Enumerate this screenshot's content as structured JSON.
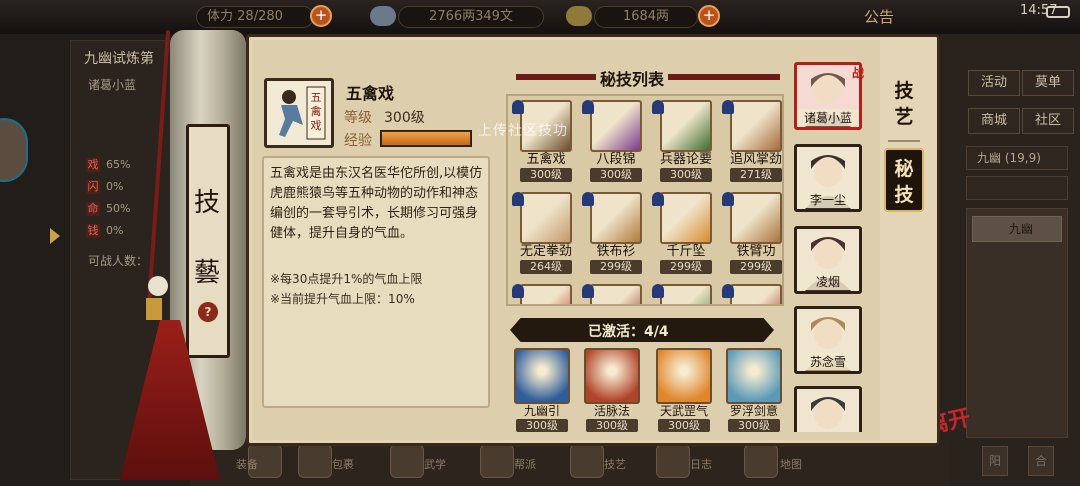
{
  "topbar": {
    "stamina_label": "体力",
    "stamina": "28/280",
    "copper": "2766两349文",
    "silver": "1684两",
    "notice": "公告",
    "clock": "14:57"
  },
  "left_panel": {
    "title": "九幽试炼第",
    "player": "诸葛小蓝",
    "stats": [
      {
        "key": "戏",
        "value": "65%"
      },
      {
        "key": "闪",
        "value": "0%"
      },
      {
        "key": "命",
        "value": "50%"
      },
      {
        "key": "钱",
        "value": "0%"
      }
    ],
    "fight_count_label": "可战人数："
  },
  "right_panel": {
    "buttons": [
      "活动",
      "莫单",
      "商城",
      "社区"
    ],
    "row_label": "九幽",
    "row_value": "(19,9)",
    "list_item": "九幽",
    "small_buttons": [
      "阳",
      "合"
    ]
  },
  "bottom_bar": {
    "labels": [
      "装备",
      "包裹",
      "武学",
      "帮派",
      "技艺",
      "日志",
      "地图"
    ]
  },
  "scroll": {
    "chars": [
      "技",
      "藝"
    ],
    "badge": "?"
  },
  "detail": {
    "name": "五禽戏",
    "level_label": "等级",
    "level": "300级",
    "exp_label": "经验",
    "exp_fill": 1.0,
    "description": "五禽戏是由东汉名医华佗所创,以模仿虎鹿熊猿鸟等五种动物的动作和神态编创的一套导引术，长期修习可强身健体，提升自身的气血。",
    "bonus_1": "※每30点提升1%的气血上限",
    "bonus_2": "※当前提升气血上限：10%"
  },
  "skill_list": {
    "title": "秘技列表",
    "watermark": "上传社区技功",
    "items": [
      {
        "name": "五禽戏",
        "level": "300级",
        "color": "#6c4a2e"
      },
      {
        "name": "八段锦",
        "level": "300级",
        "color": "#7b3a8c"
      },
      {
        "name": "兵器论要",
        "level": "300级",
        "color": "#3c6e2e"
      },
      {
        "name": "追风掌劲",
        "level": "271级",
        "color": "#a46a3c"
      },
      {
        "name": "无定拳劲",
        "level": "264级",
        "color": "#c39a6a"
      },
      {
        "name": "铁布衫",
        "level": "299级",
        "color": "#b07a3a"
      },
      {
        "name": "千斤坠",
        "level": "299级",
        "color": "#d88a2c"
      },
      {
        "name": "铁臂功",
        "level": "299级",
        "color": "#a8743c"
      },
      {
        "name": "",
        "level": "",
        "color": "#c0392b"
      },
      {
        "name": "",
        "level": "",
        "color": "#8e2a1a"
      },
      {
        "name": "",
        "level": "",
        "color": "#4e7a3c"
      },
      {
        "name": "",
        "level": "",
        "color": "#9a2e22"
      }
    ]
  },
  "activated": {
    "label": "已激活：4/4",
    "items": [
      {
        "name": "九幽引",
        "level": "300级",
        "color": "#2e5e9a"
      },
      {
        "name": "活脉法",
        "level": "300级",
        "color": "#b0442a"
      },
      {
        "name": "天武罡气",
        "level": "300级",
        "color": "#e0862c"
      },
      {
        "name": "罗浮剑意",
        "level": "300级",
        "color": "#5a9ab8"
      }
    ]
  },
  "characters": [
    {
      "name": "诸葛小蓝",
      "color": "#6e5a4e",
      "selected": true
    },
    {
      "name": "李一尘",
      "color": "#3a3030",
      "selected": false
    },
    {
      "name": "凌烟",
      "color": "#4a3030",
      "selected": false
    },
    {
      "name": "苏念雪",
      "color": "#b08a5a",
      "selected": false
    },
    {
      "name": "",
      "color": "#3a3a3a",
      "selected": false
    }
  ],
  "fight_tag": "战",
  "tabs": {
    "skill": "技艺",
    "secret": "秘技"
  }
}
